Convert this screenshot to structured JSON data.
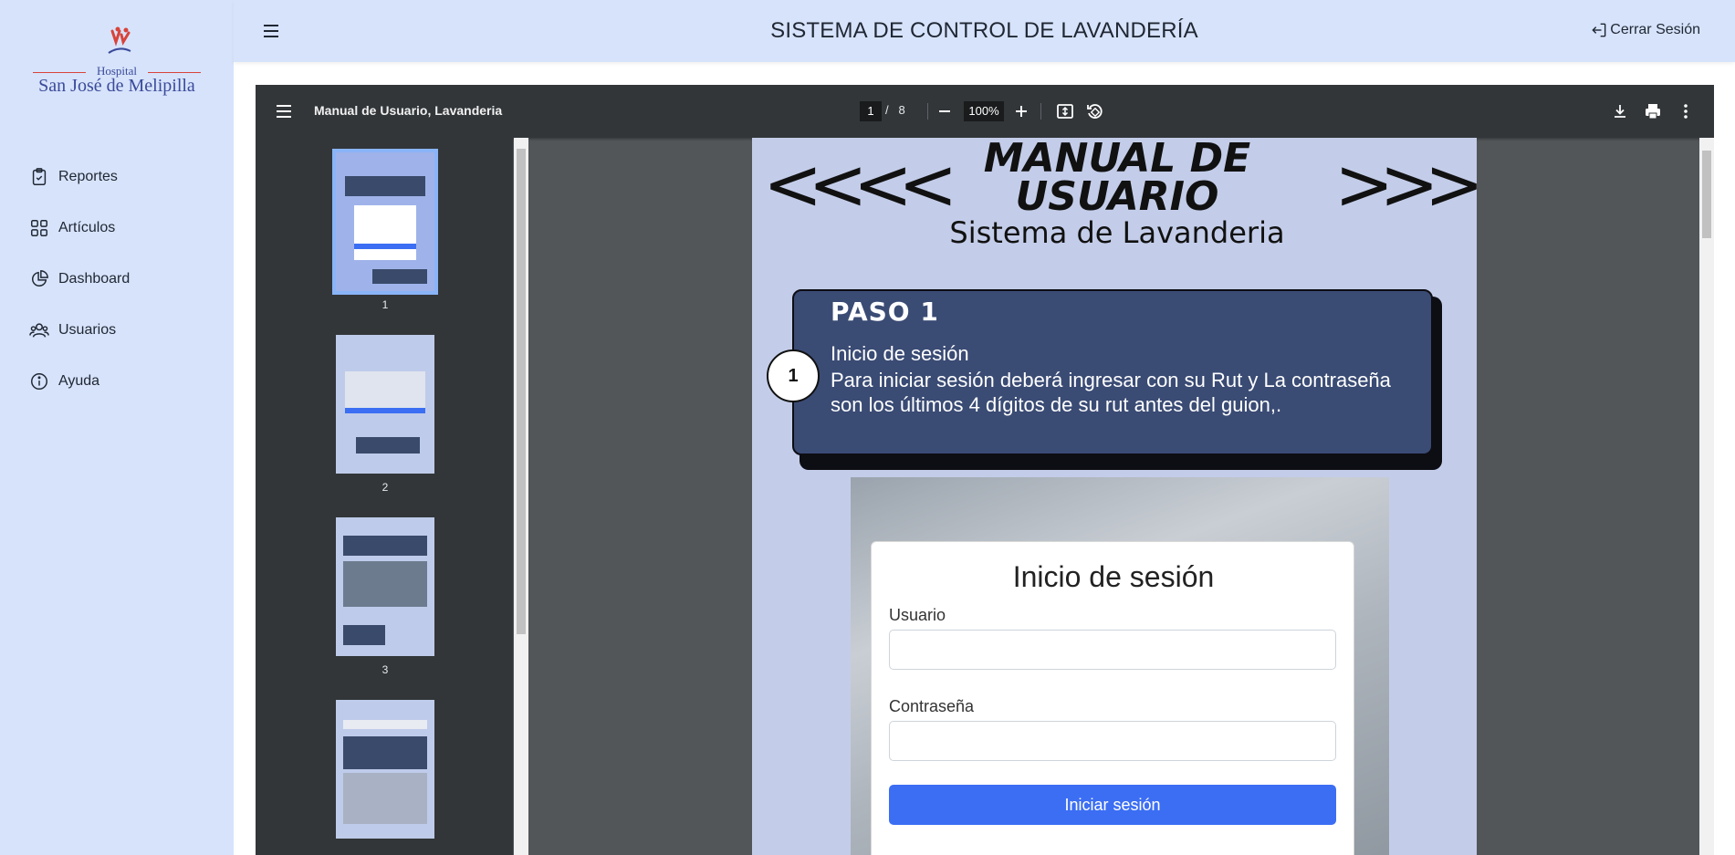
{
  "sidebar": {
    "logo": {
      "hospital_word": "Hospital",
      "name": "San José de Melipilla"
    },
    "items": [
      {
        "label": "Reportes",
        "icon": "clipboard-check-icon"
      },
      {
        "label": "Artículos",
        "icon": "grid-icon"
      },
      {
        "label": "Dashboard",
        "icon": "pie-chart-icon"
      },
      {
        "label": "Usuarios",
        "icon": "users-icon"
      },
      {
        "label": "Ayuda",
        "icon": "info-icon"
      }
    ]
  },
  "header": {
    "title": "SISTEMA DE CONTROL DE LAVANDERÍA",
    "logout_label": "Cerrar Sesión"
  },
  "viewer": {
    "doc_title": "Manual de Usuario, Lavanderia",
    "current_page": "1",
    "page_separator": "/",
    "total_pages": "8",
    "zoom": "100%",
    "thumbnails": [
      {
        "number": "1"
      },
      {
        "number": "2"
      },
      {
        "number": "3"
      }
    ]
  },
  "page": {
    "arrows_left": "<<<<",
    "arrows_right": ">>>>",
    "title": "MANUAL DE USUARIO",
    "subtitle": "Sistema de Lavanderia",
    "step_number": "1",
    "paso_heading": "PASO 1",
    "paso_title": "Inicio de sesión",
    "paso_text": "Para iniciar sesión deberá ingresar con su Rut y La contraseña son los últimos 4 dígitos de su rut antes del guion,.",
    "login": {
      "title": "Inicio de sesión",
      "user_label": "Usuario",
      "password_label": "Contraseña",
      "button": "Iniciar sesión"
    }
  },
  "colors": {
    "sidebar_bg": "#d7e3fb",
    "viewer_bg": "#525659",
    "toolbar_bg": "#323639",
    "paso_bg": "#3a4b74",
    "login_button": "#3b6ef3"
  }
}
